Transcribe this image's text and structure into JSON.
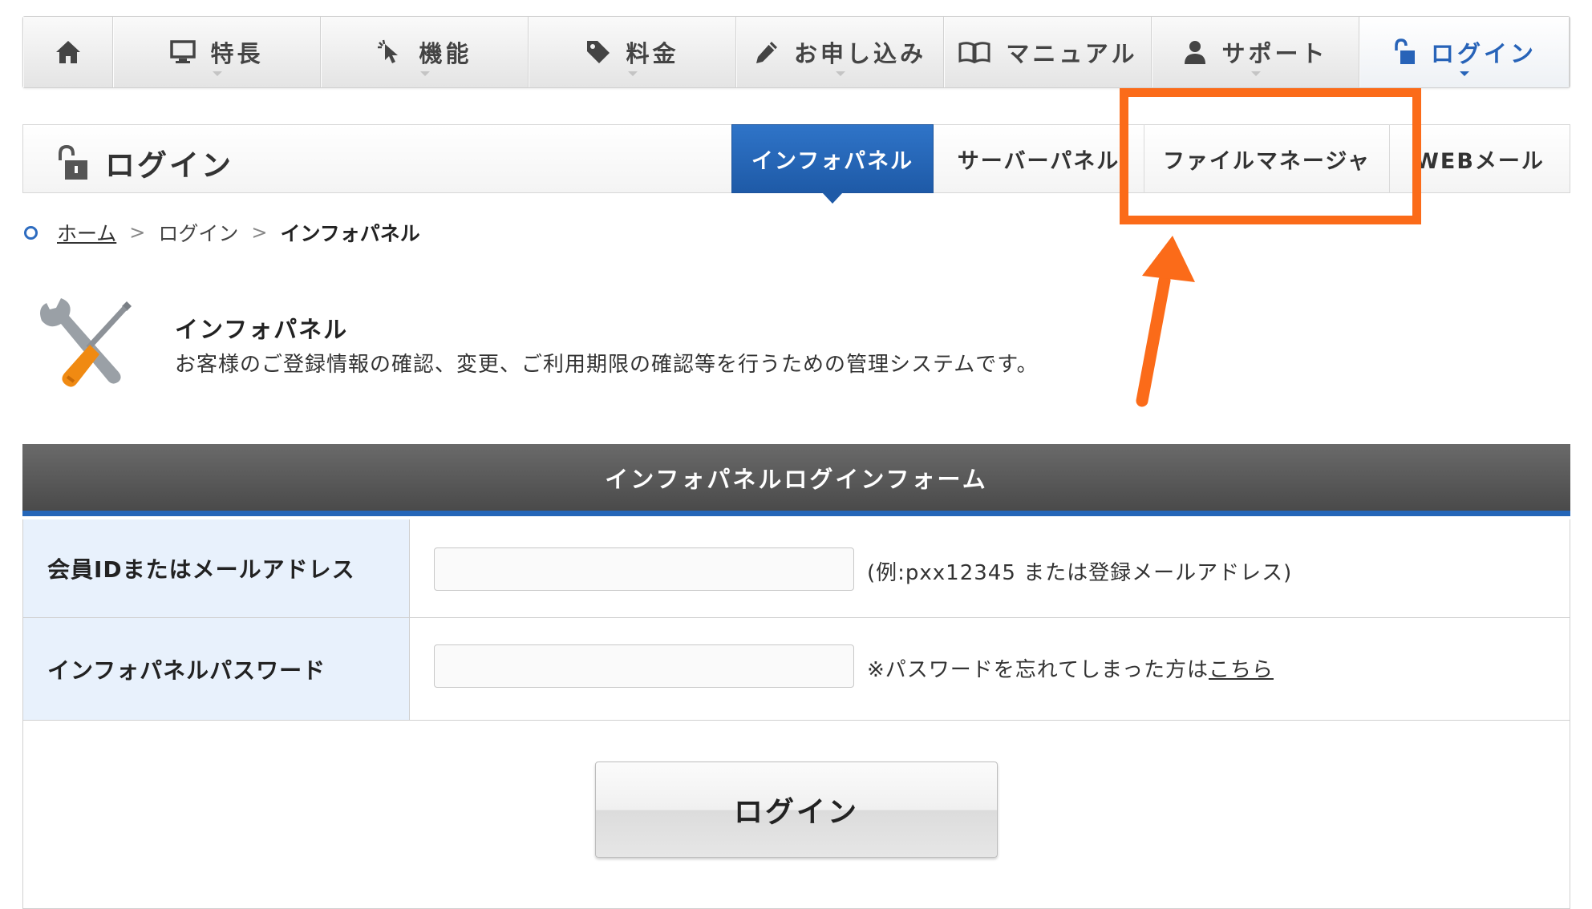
{
  "topnav": {
    "items": [
      {
        "label": "",
        "icon": "home-icon"
      },
      {
        "label": "特長",
        "icon": "monitor-icon"
      },
      {
        "label": "機能",
        "icon": "cursor-icon"
      },
      {
        "label": "料金",
        "icon": "tag-icon"
      },
      {
        "label": "お申し込み",
        "icon": "pencil-icon"
      },
      {
        "label": "マニュアル",
        "icon": "book-icon"
      },
      {
        "label": "サポート",
        "icon": "person-icon"
      },
      {
        "label": "ログイン",
        "icon": "unlock-icon",
        "active": true
      }
    ]
  },
  "subheader": {
    "title": "ログイン",
    "tabs": [
      {
        "label": "インフォパネル",
        "active": true
      },
      {
        "label": "サーバーパネル"
      },
      {
        "label": "ファイルマネージャ"
      },
      {
        "label": "WEBメール"
      }
    ]
  },
  "breadcrumb": {
    "home": "ホーム",
    "login": "ログイン",
    "current": "インフォパネル",
    "separator": ">"
  },
  "intro": {
    "title": "インフォパネル",
    "description": "お客様のご登録情報の確認、変更、ご利用期限の確認等を行うための管理システムです。",
    "icon": "tools-icon"
  },
  "form": {
    "heading": "インフォパネルログインフォーム",
    "id_label": "会員IDまたはメールアドレス",
    "id_value": "",
    "id_note": "(例:pxx12345 または登録メールアドレス)",
    "password_label": "インフォパネルパスワード",
    "password_value": "",
    "password_note": "※パスワードを忘れてしまった方は",
    "password_link": "こちら",
    "submit_label": "ログイン"
  },
  "colors": {
    "accent_blue": "#2566b8",
    "annotation_orange": "#fb6b19",
    "label_background": "#e8f1fc"
  }
}
